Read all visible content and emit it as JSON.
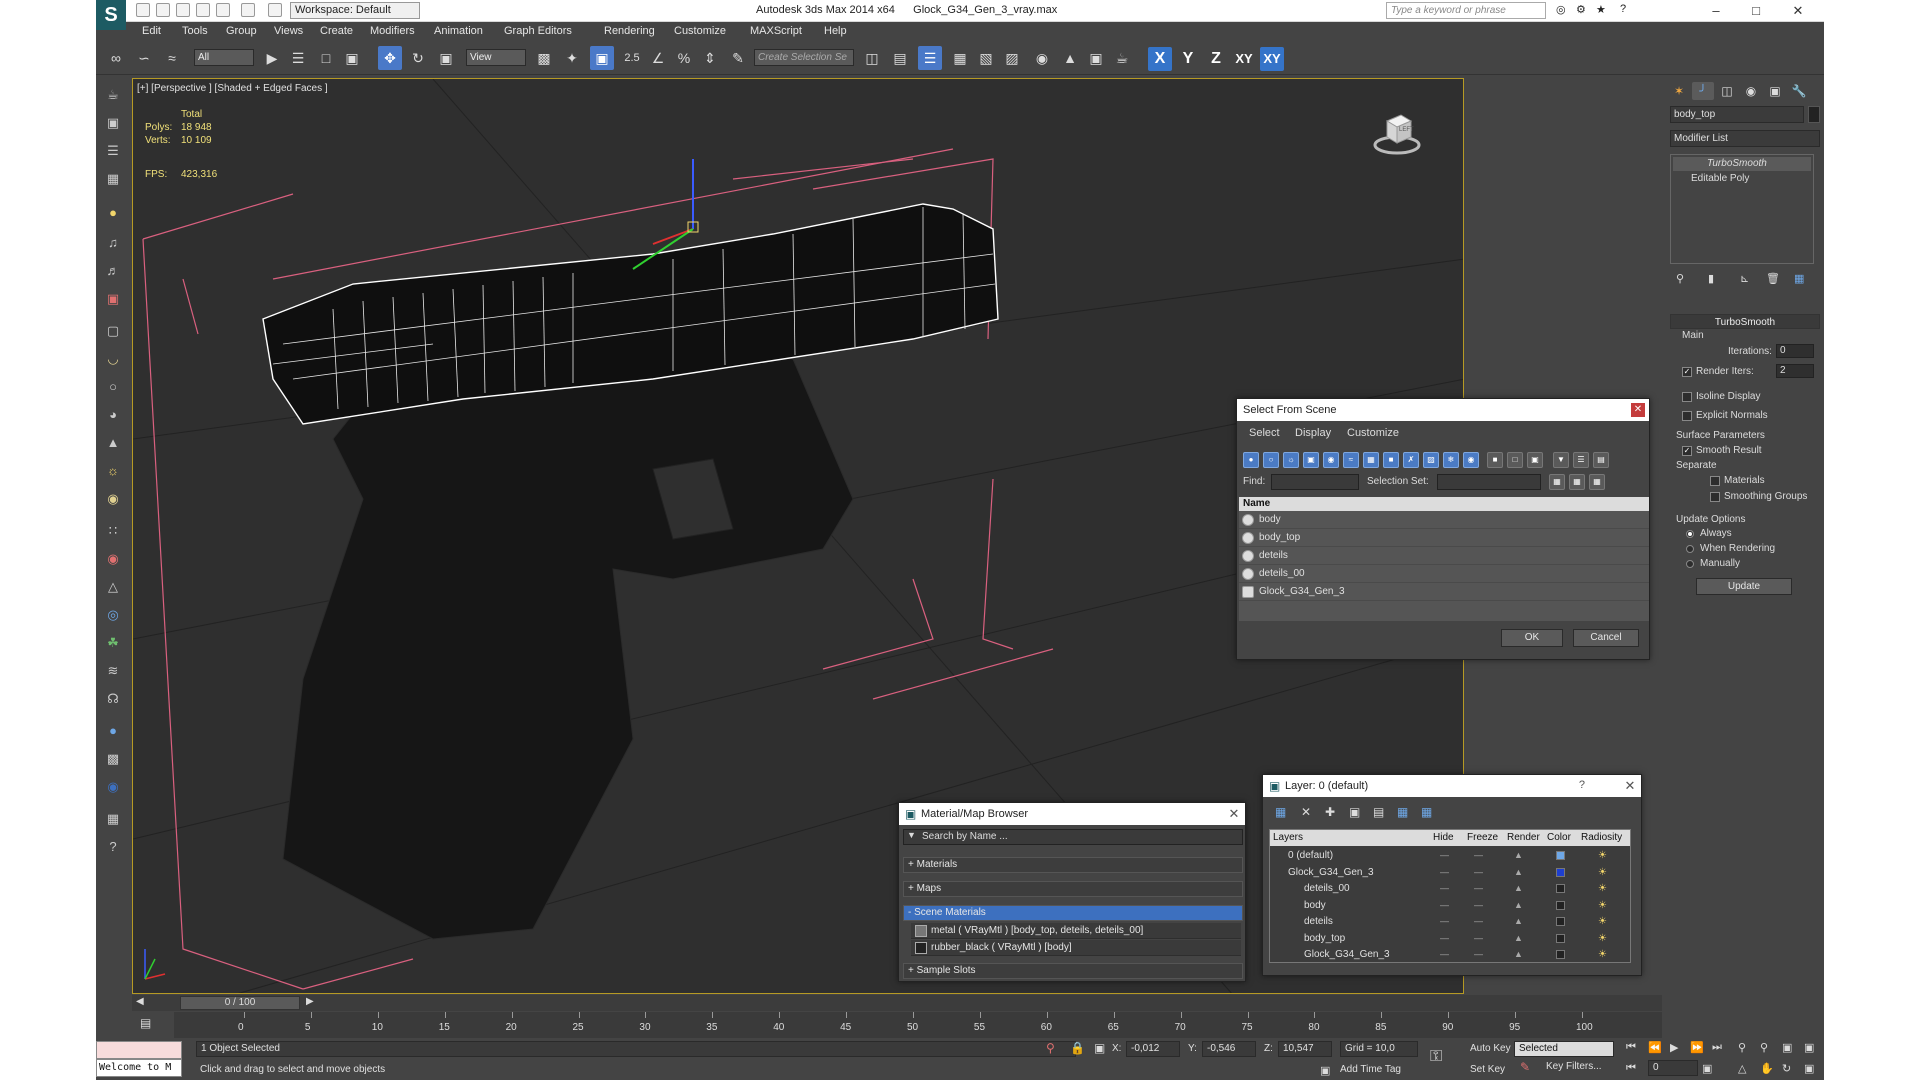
{
  "app": {
    "title": "Autodesk 3ds Max  2014 x64",
    "file": "Glock_G34_Gen_3_vray.max",
    "workspace": "Workspace: Default",
    "search_placeholder": "Type a keyword or phrase"
  },
  "menu": [
    "Edit",
    "Tools",
    "Group",
    "Views",
    "Create",
    "Modifiers",
    "Animation",
    "Graph Editors",
    "Rendering",
    "Customize",
    "MAXScript",
    "Help"
  ],
  "toolbar": {
    "filter": "All",
    "ref_coord": "View",
    "snap_value": "2.5",
    "selection_set_placeholder": "Create Selection Se",
    "axes": [
      "X",
      "Y",
      "Z",
      "XY",
      "XY"
    ]
  },
  "viewport": {
    "label": "[+] [Perspective ] [Shaded + Edged Faces ]",
    "stats": {
      "total_label": "Total",
      "polys_label": "Polys:",
      "polys_value": "18 948",
      "verts_label": "Verts:",
      "verts_value": "10 109",
      "fps_label": "FPS:",
      "fps_value": "423,316"
    },
    "viewcube_label": "LEFT"
  },
  "command_panel": {
    "object_name": "body_top",
    "modifier_list": "Modifier List",
    "stack": [
      "TurboSmooth",
      "Editable Poly"
    ],
    "rollout_title": "TurboSmooth",
    "main_label": "Main",
    "iterations_label": "Iterations:",
    "iterations_value": "0",
    "render_iters_label": "Render Iters:",
    "render_iters_value": "2",
    "isoline_label": "Isoline Display",
    "explicit_normals_label": "Explicit Normals",
    "surface_params_label": "Surface Parameters",
    "smooth_result_label": "Smooth Result",
    "separate_label": "Separate",
    "materials_label": "Materials",
    "smoothing_groups_label": "Smoothing Groups",
    "update_options_label": "Update Options",
    "always_label": "Always",
    "when_rendering_label": "When Rendering",
    "manually_label": "Manually",
    "update_button": "Update"
  },
  "select_from_scene": {
    "title": "Select From Scene",
    "menu": [
      "Select",
      "Display",
      "Customize"
    ],
    "find_label": "Find:",
    "selection_set_label": "Selection Set:",
    "column_name": "Name",
    "rows": [
      "body",
      "body_top",
      "deteils",
      "deteils_00",
      "Glock_G34_Gen_3"
    ],
    "ok": "OK",
    "cancel": "Cancel"
  },
  "material_browser": {
    "title": "Material/Map Browser",
    "search_placeholder": "Search by Name ...",
    "sections": [
      "+ Materials",
      "+ Maps",
      "- Scene Materials"
    ],
    "materials": [
      "metal  ( VRayMtl ) [body_top, deteils, deteils_00]",
      "rubber_black  ( VRayMtl ) [body]"
    ],
    "sample_slots": "+ Sample Slots"
  },
  "layer_manager": {
    "title": "Layer: 0 (default)",
    "help": "?",
    "columns": [
      "Layers",
      "Hide",
      "Freeze",
      "Render",
      "Color",
      "Radiosity"
    ],
    "rows": [
      {
        "name": "0 (default)",
        "indent": 1,
        "color": "#6ea7e6"
      },
      {
        "name": "Glock_G34_Gen_3",
        "indent": 1,
        "color": "#1e3fd0"
      },
      {
        "name": "deteils_00",
        "indent": 2,
        "color": "#222222"
      },
      {
        "name": "body",
        "indent": 2,
        "color": "#222222"
      },
      {
        "name": "deteils",
        "indent": 2,
        "color": "#222222"
      },
      {
        "name": "body_top",
        "indent": 2,
        "color": "#222222"
      },
      {
        "name": "Glock_G34_Gen_3",
        "indent": 2,
        "color": "#222222"
      }
    ]
  },
  "timeline": {
    "frame": "0 / 100",
    "ticks": [
      "0",
      "5",
      "10",
      "15",
      "20",
      "25",
      "30",
      "35",
      "40",
      "45",
      "50",
      "55",
      "60",
      "65",
      "70",
      "75",
      "80",
      "85",
      "90",
      "95",
      "100"
    ]
  },
  "status": {
    "maxscript": "",
    "welcome": "Welcome to M",
    "selected": "1 Object Selected",
    "prompt": "Click and drag to select and move objects",
    "x_label": "X:",
    "x_value": "-0,012",
    "y_label": "Y:",
    "y_value": "-0,546",
    "z_label": "Z:",
    "z_value": "10,547",
    "grid": "Grid = 10,0",
    "add_time_tag": "Add Time Tag",
    "auto_key": "Auto Key",
    "set_key": "Set Key",
    "key_mode": "Selected",
    "key_filters": "Key Filters...",
    "frame_field": "0"
  }
}
